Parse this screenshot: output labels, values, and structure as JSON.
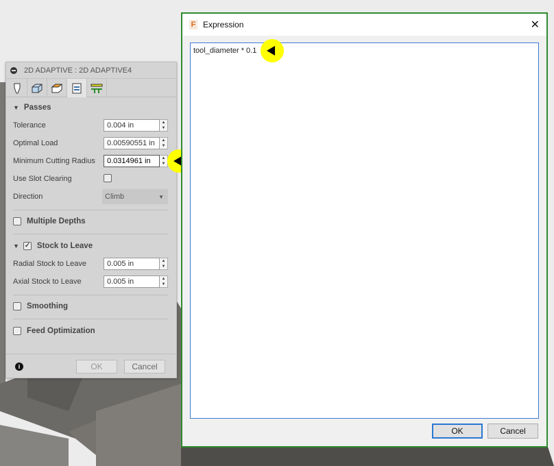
{
  "panel": {
    "title": "2D ADAPTIVE : 2D ADAPTIVE4",
    "tabs": [
      "tool-tab",
      "geometry-tab",
      "heights-tab",
      "passes-tab",
      "linking-tab"
    ],
    "passes": {
      "heading": "Passes",
      "tolerance": {
        "label": "Tolerance",
        "value": "0.004 in"
      },
      "optimal_load": {
        "label": "Optimal Load",
        "value": "0.00590551 in"
      },
      "min_radius": {
        "label": "Minimum Cutting Radius",
        "value": "0.0314961 in"
      },
      "slot": {
        "label": "Use Slot Clearing"
      },
      "direction": {
        "label": "Direction",
        "value": "Climb"
      }
    },
    "multiple_depths": "Multiple Depths",
    "stock": {
      "heading": "Stock to Leave",
      "radial": {
        "label": "Radial Stock to Leave",
        "value": "0.005 in"
      },
      "axial": {
        "label": "Axial Stock to Leave",
        "value": "0.005 in"
      }
    },
    "smoothing": "Smoothing",
    "feed": "Feed Optimization",
    "ok": "OK",
    "cancel": "Cancel"
  },
  "dialog": {
    "title": "Expression",
    "expression": "tool_diameter * 0.1",
    "ok": "OK",
    "cancel": "Cancel"
  },
  "colors": {
    "accent": "#3d7bd4",
    "border": "#2e8b2e",
    "marker": "#ffff00"
  }
}
